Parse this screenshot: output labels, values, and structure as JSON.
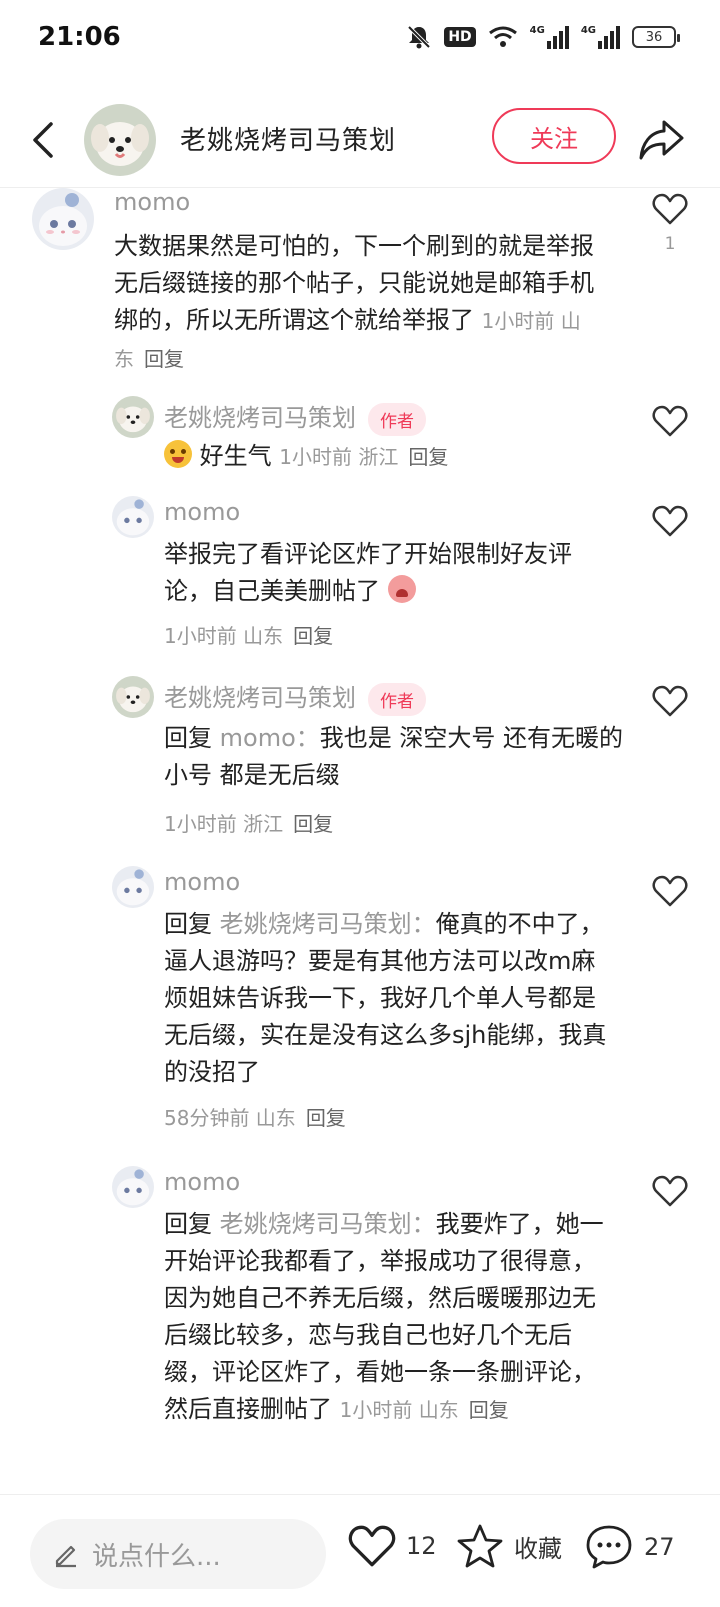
{
  "status_bar": {
    "time": "21:06",
    "hd": "HD",
    "net1": "4G",
    "net2": "4G",
    "battery": "36"
  },
  "header": {
    "author_name": "老姚烧烤司马策划",
    "follow_label": "关注"
  },
  "comments": [
    {
      "name": "momo",
      "text": "大数据果然是可怕的，下一个刷到的就是举报无后缀链接的那个帖子，只能说她是邮箱手机绑的，所以无所谓这个就给举报了",
      "meta": "1小时前 山东",
      "reply": "回复",
      "likes": "1"
    },
    {
      "name": "老姚烧烤司马策划",
      "badge": "作者",
      "text": "好生气",
      "meta": "1小时前 浙江",
      "reply": "回复"
    },
    {
      "name": "momo",
      "text": "举报完了看评论区炸了开始限制好友评论，自己美美删帖了",
      "meta": "1小时前 山东",
      "reply": "回复"
    },
    {
      "name": "老姚烧烤司马策划",
      "badge": "作者",
      "reply_prefix": "回复",
      "reply_target": "momo：",
      "text": "我也是 深空大号 还有无暖的小号 都是无后缀",
      "meta": "1小时前 浙江",
      "reply": "回复"
    },
    {
      "name": "momo",
      "reply_prefix": "回复",
      "reply_target": "老姚烧烤司马策划：",
      "text": "俺真的不中了，逼人退游吗？要是有其他方法可以改m麻烦姐妹告诉我一下，我好几个单人号都是无后缀，实在是没有这么多sjh能绑，我真的没招了",
      "meta": "58分钟前 山东",
      "reply": "回复"
    },
    {
      "name": "momo",
      "reply_prefix": "回复",
      "reply_target": "老姚烧烤司马策划：",
      "text": "我要炸了，她一开始评论我都看了，举报成功了很得意，因为她自己不养无后缀，然后暖暖那边无后缀比较多，恋与我自己也好几个无后缀，评论区炸了，看她一条一条删评论，然后直接删帖了",
      "meta": "1小时前 山东",
      "reply": "回复"
    }
  ],
  "bottom_bar": {
    "input_placeholder": "说点什么...",
    "like_count": "12",
    "collect_label": "收藏",
    "comment_count": "27"
  },
  "colors": {
    "accent": "#ef3a58",
    "muted": "#999999"
  }
}
